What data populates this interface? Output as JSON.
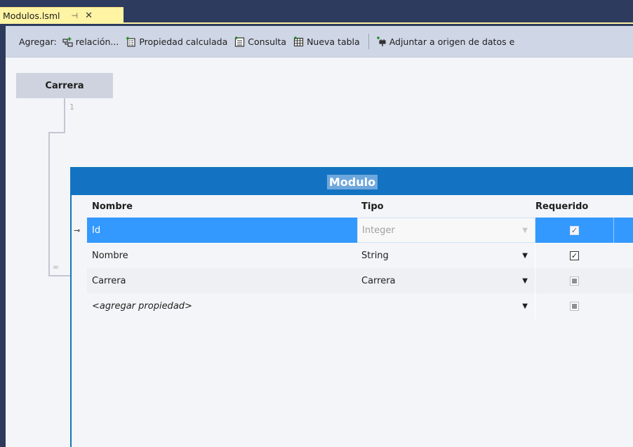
{
  "tab": {
    "title": "Modulos.lsml",
    "pin_glyph": "⊣",
    "close_glyph": "✕"
  },
  "toolbar": {
    "add_label": "Agregar:",
    "buttons": [
      {
        "label": "relación...",
        "icon": "relation-icon"
      },
      {
        "label": "Propiedad calculada",
        "icon": "computed-property-icon"
      },
      {
        "label": "Consulta",
        "icon": "query-icon"
      },
      {
        "label": "Nueva tabla",
        "icon": "new-table-icon"
      },
      {
        "label": "Adjuntar a origen de datos e",
        "icon": "attach-datasource-icon"
      }
    ]
  },
  "designer": {
    "related_entity": {
      "name": "Carrera",
      "multiplicity_one": "1",
      "multiplicity_many": "∞"
    },
    "entity": {
      "name": "Modulo",
      "columns": {
        "name": "Nombre",
        "type": "Tipo",
        "required": "Requerido"
      },
      "rows": [
        {
          "name": "Id",
          "type": "Integer",
          "required": "checked",
          "is_key": true,
          "selected": true
        },
        {
          "name": "Nombre",
          "type": "String",
          "required": "checked",
          "is_key": false,
          "selected": false
        },
        {
          "name": "Carrera",
          "type": "Carrera",
          "required": "indeterminate",
          "is_key": false,
          "selected": false
        },
        {
          "name": "<agregar propiedad>",
          "type": "",
          "required": "indeterminate",
          "is_key": false,
          "selected": false
        }
      ]
    }
  },
  "colors": {
    "accent": "#1373c2",
    "selection": "#3399ff",
    "tab": "#fef4a4",
    "chrome": "#2c3b5e"
  }
}
